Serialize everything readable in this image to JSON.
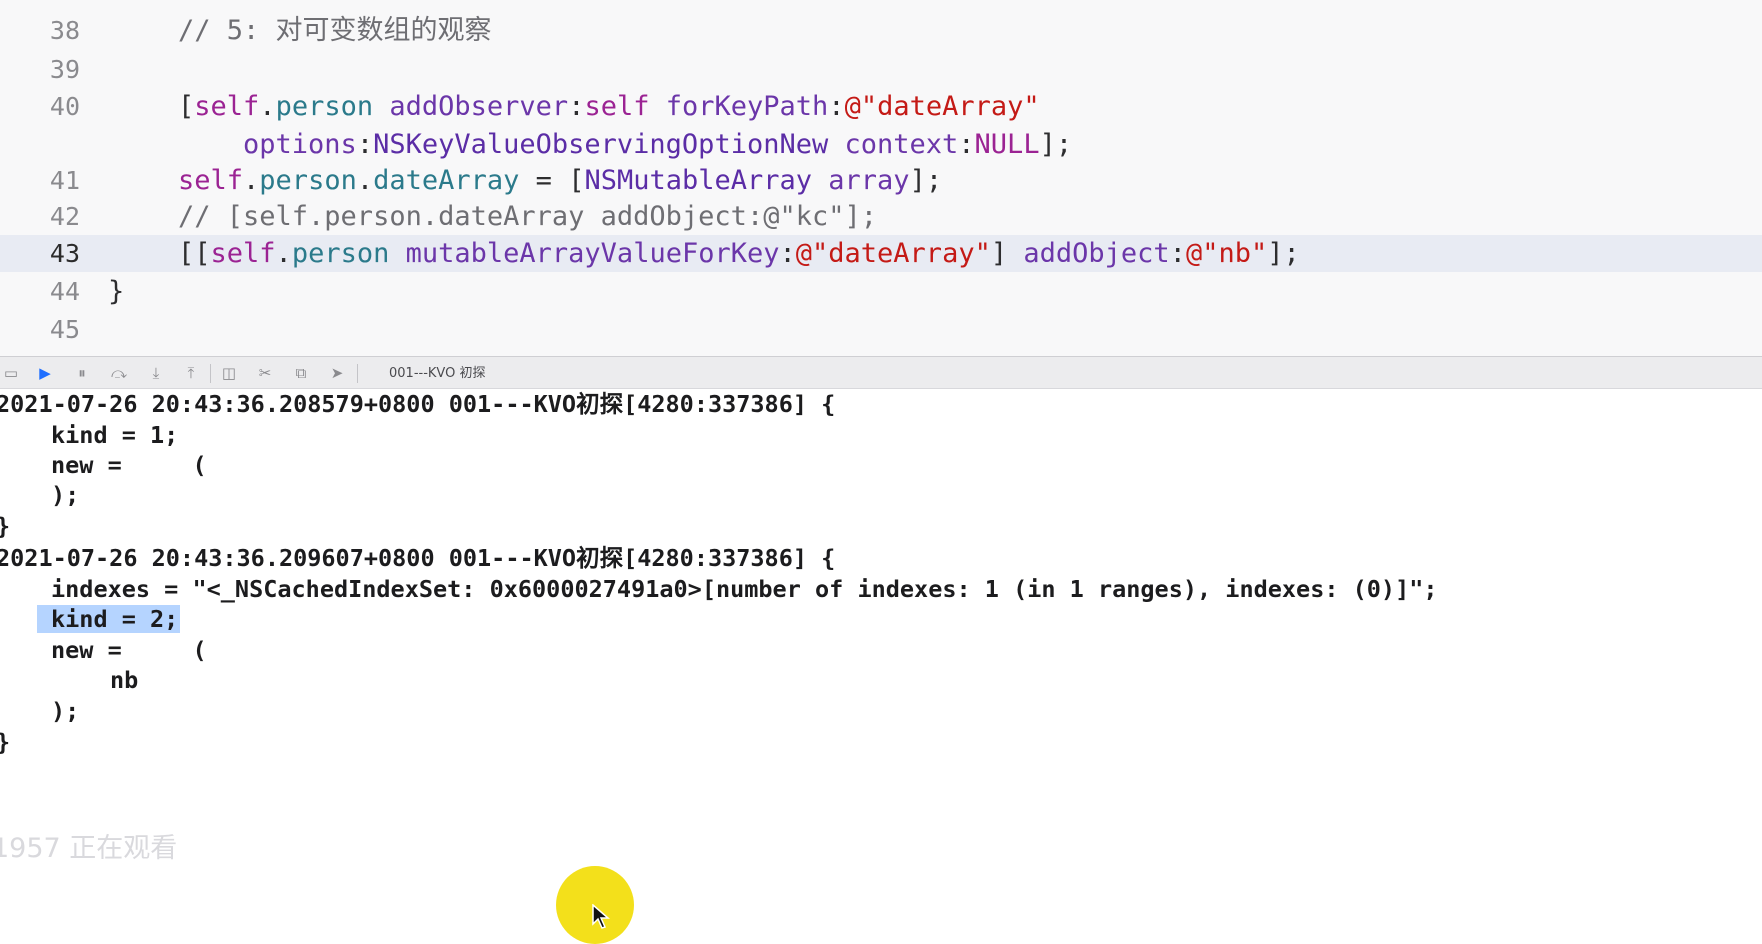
{
  "editor": {
    "lines": [
      {
        "num": "38",
        "code": [
          {
            "t": "// 5: 对可变数组的观察",
            "c": "comment"
          }
        ]
      },
      {
        "num": "39",
        "code": []
      },
      {
        "num": "40",
        "code": [
          {
            "t": "[",
            "c": "br"
          },
          {
            "t": "self",
            "c": "self"
          },
          {
            "t": ".",
            "c": "br"
          },
          {
            "t": "person",
            "c": "prop"
          },
          {
            "t": " addObserver",
            "c": "meth"
          },
          {
            "t": ":",
            "c": "br"
          },
          {
            "t": "self",
            "c": "self"
          },
          {
            "t": " forKeyPath",
            "c": "meth"
          },
          {
            "t": ":",
            "c": "br"
          },
          {
            "t": "@\"dateArray\"",
            "c": "str"
          }
        ]
      },
      {
        "num": "",
        "code": [
          {
            "t": "    options",
            "c": "meth"
          },
          {
            "t": ":",
            "c": "br"
          },
          {
            "t": "NSKeyValueObservingOptionNew",
            "c": "type"
          },
          {
            "t": " context",
            "c": "meth"
          },
          {
            "t": ":",
            "c": "br"
          },
          {
            "t": "NULL",
            "c": "null"
          },
          {
            "t": "];",
            "c": "br"
          }
        ]
      },
      {
        "num": "41",
        "code": [
          {
            "t": "self",
            "c": "self"
          },
          {
            "t": ".",
            "c": "br"
          },
          {
            "t": "person",
            "c": "prop"
          },
          {
            "t": ".",
            "c": "br"
          },
          {
            "t": "dateArray",
            "c": "prop"
          },
          {
            "t": " = [",
            "c": "br"
          },
          {
            "t": "NSMutableArray",
            "c": "type"
          },
          {
            "t": " array",
            "c": "meth"
          },
          {
            "t": "];",
            "c": "br"
          }
        ]
      },
      {
        "num": "42",
        "code": [
          {
            "t": "// [self.person.dateArray addObject:@\"kc\"];",
            "c": "comment"
          }
        ]
      },
      {
        "num": "43",
        "current": true,
        "code": [
          {
            "t": "[[",
            "c": "br"
          },
          {
            "t": "self",
            "c": "self"
          },
          {
            "t": ".",
            "c": "br"
          },
          {
            "t": "person",
            "c": "prop"
          },
          {
            "t": " mutableArrayValueForKey",
            "c": "meth"
          },
          {
            "t": ":",
            "c": "br"
          },
          {
            "t": "@\"dateArray\"",
            "c": "str"
          },
          {
            "t": "] ",
            "c": "br"
          },
          {
            "t": "addObject",
            "c": "meth"
          },
          {
            "t": ":",
            "c": "br"
          },
          {
            "t": "@\"nb\"",
            "c": "str"
          },
          {
            "t": "];",
            "c": "br"
          }
        ]
      },
      {
        "num": "44",
        "code": [
          {
            "t": "}",
            "c": "br"
          }
        ]
      },
      {
        "num": "45",
        "code": []
      }
    ]
  },
  "debug_bar": {
    "buttons": [
      {
        "icon": "hide-console-icon",
        "glyph": "▭"
      },
      {
        "icon": "breakpoints-toggle-icon",
        "glyph": "▶"
      },
      {
        "icon": "pause-icon",
        "glyph": "⏸"
      },
      {
        "icon": "step-over-icon",
        "glyph": "⤼"
      },
      {
        "icon": "step-into-icon",
        "glyph": "⤓"
      },
      {
        "icon": "step-out-icon",
        "glyph": "⤒"
      },
      {
        "icon": "view-hierarchy-icon",
        "glyph": "◫"
      },
      {
        "icon": "memory-graph-icon",
        "glyph": "✂"
      },
      {
        "icon": "environment-overrides-icon",
        "glyph": "⧉"
      },
      {
        "icon": "simulate-location-icon",
        "glyph": "➤"
      }
    ],
    "scheme_label": "001---KVO 初探"
  },
  "console": {
    "lines": [
      {
        "text": "2021-07-26 20:43:36.208579+0800 001---KVO初探[4280:337386] {",
        "indent": 0
      },
      {
        "text": "kind = 1;",
        "indent": 1
      },
      {
        "text": "new =     (",
        "indent": 1
      },
      {
        "text": ");",
        "indent": 1
      },
      {
        "text": "}",
        "indent": 0
      },
      {
        "text": "2021-07-26 20:43:36.209607+0800 001---KVO初探[4280:337386] {",
        "indent": 0
      },
      {
        "text": "indexes = \"<_NSCachedIndexSet: 0x6000027491a0>[number of indexes: 1 (in 1 ranges), indexes: (0)]\";",
        "indent": 1
      },
      {
        "text": "kind = 2;",
        "indent": 1,
        "selected": true
      },
      {
        "text": "new =     (",
        "indent": 1
      },
      {
        "text": "nb",
        "indent": 2
      },
      {
        "text": ");",
        "indent": 1
      },
      {
        "text": "}",
        "indent": 0
      }
    ]
  },
  "overlay": {
    "watching": "1957 正在观看"
  }
}
